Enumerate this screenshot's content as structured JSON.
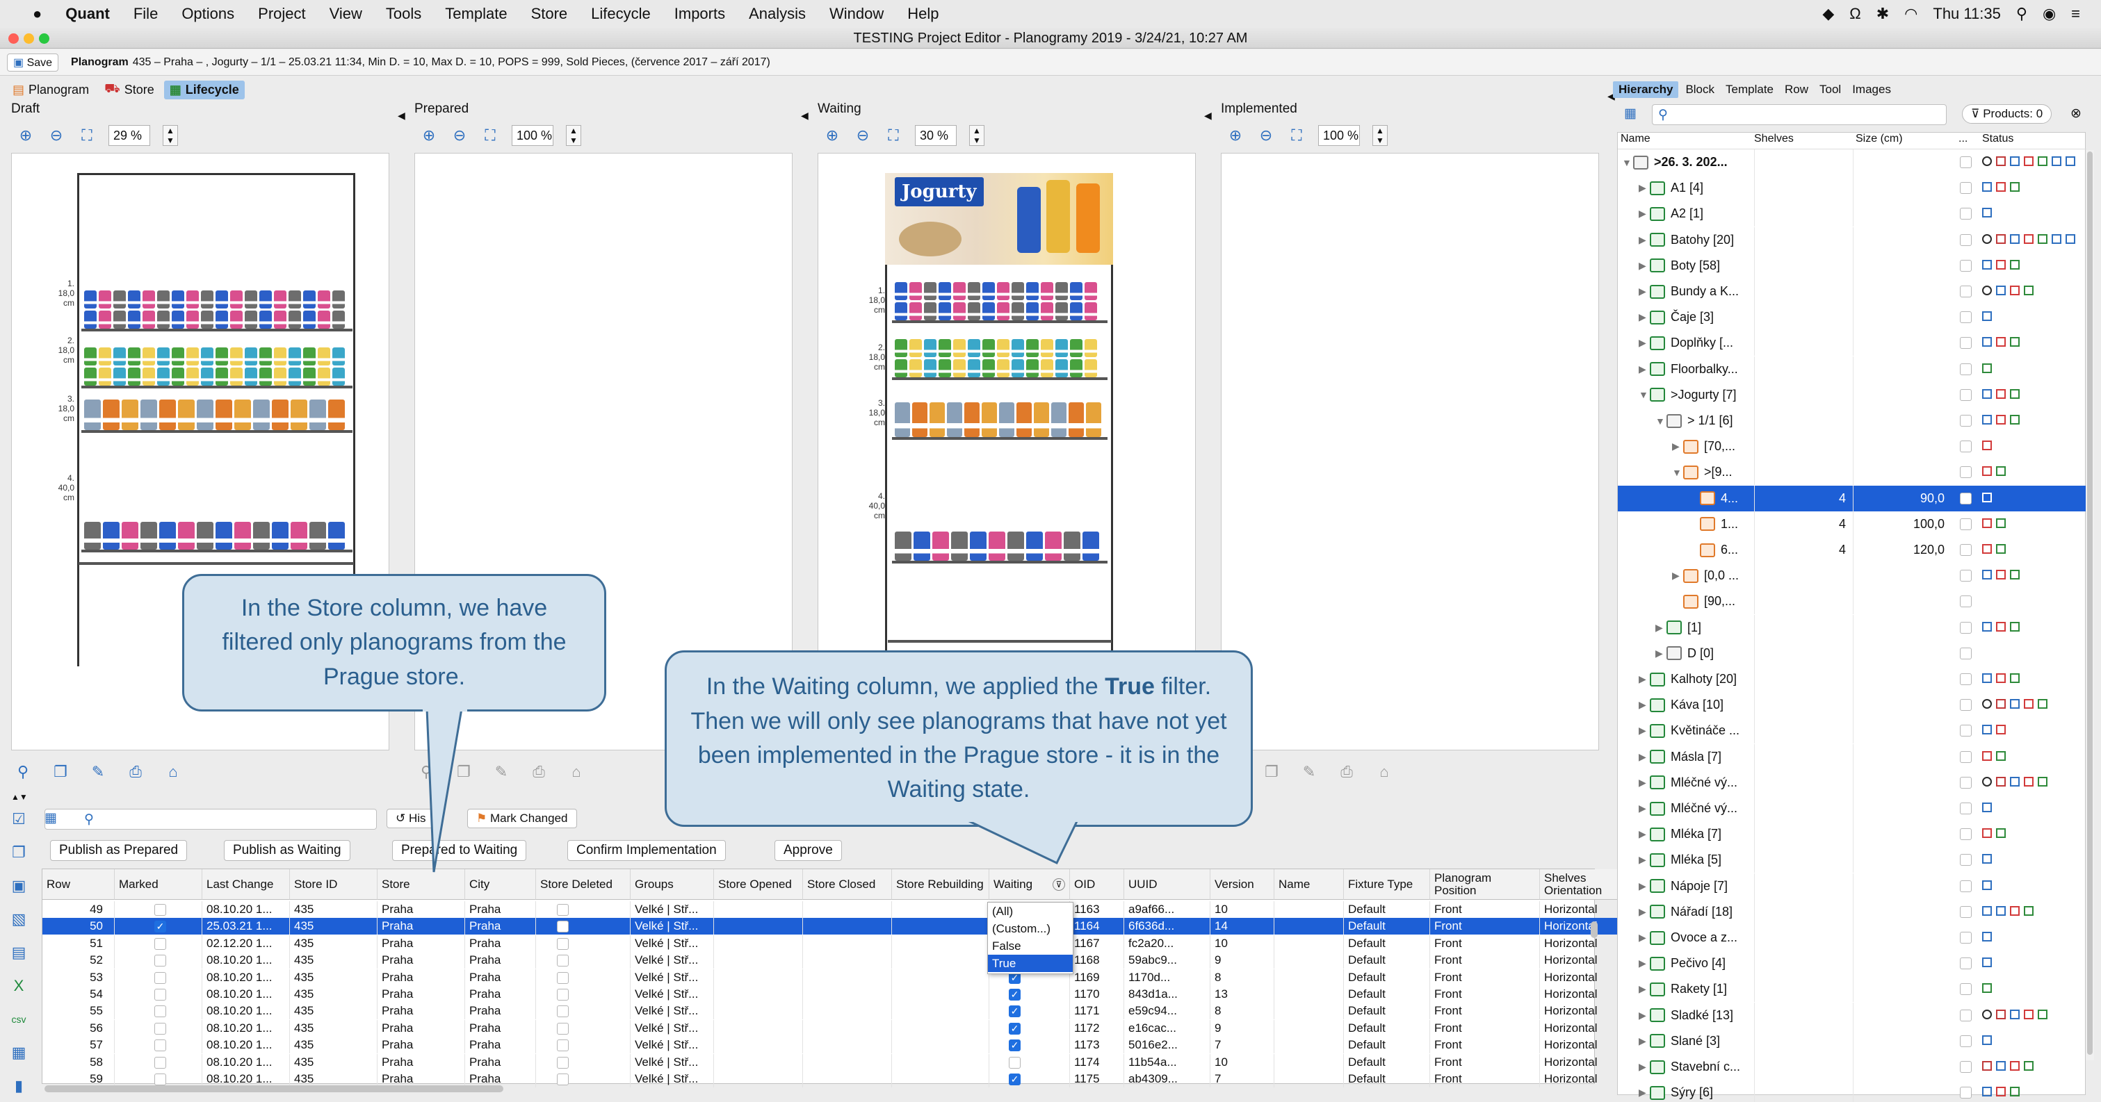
{
  "menubar": {
    "app": "Quant",
    "items": [
      "File",
      "Options",
      "Project",
      "View",
      "Tools",
      "Template",
      "Store",
      "Lifecycle",
      "Imports",
      "Analysis",
      "Window",
      "Help"
    ],
    "clock": "Thu 11:35"
  },
  "window": {
    "title": "TESTING Project Editor - Planogramy 2019 - 3/24/21, 10:27 AM"
  },
  "toolbar": {
    "save_label": "Save",
    "planogram_bold": "Planogram",
    "planogram_info": "435 – Praha – , Jogurty – 1/1 – 25.03.21 11:34, Min D. = 10, Max D. = 10, POPS = 999, Sold Pieces, (července 2017 – září 2017)"
  },
  "view_tabs": [
    {
      "label": "Planogram"
    },
    {
      "label": "Store"
    },
    {
      "label": "Lifecycle"
    }
  ],
  "columns": [
    {
      "title": "Draft",
      "zoom": "29 %"
    },
    {
      "title": "Prepared",
      "zoom": "100 %"
    },
    {
      "title": "Waiting",
      "zoom": "30 %"
    },
    {
      "title": "Implemented",
      "zoom": "100 %"
    }
  ],
  "draft_shelves": [
    {
      "num": "1.",
      "size": "18,0 cm"
    },
    {
      "num": "2.",
      "size": "18,0 cm"
    },
    {
      "num": "3.",
      "size": "18,0 cm"
    },
    {
      "num": "4.",
      "size": "40,0 cm"
    }
  ],
  "waiting_shelves": [
    {
      "num": "1.",
      "size": "18,0 cm"
    },
    {
      "num": "2.",
      "size": "18,0 cm"
    },
    {
      "num": "3.",
      "size": "18,0 cm"
    },
    {
      "num": "4.",
      "size": "40,0 cm"
    }
  ],
  "waiting_banner": "Jogurty",
  "callouts": {
    "store": "In the Store column, we have filtered only planograms from the Prague store.",
    "waiting_pre": "In the Waiting column, we applied the ",
    "waiting_bold": "True",
    "waiting_post": " filter. Then we will only see planograms that have not yet been implemented in the Prague store - it is in the Waiting state."
  },
  "grid_toolbar": {
    "history": "His",
    "mark_changed": "Mark Changed"
  },
  "actions": [
    "Publish as Prepared",
    "Publish as Waiting",
    "Prepared to Waiting",
    "Confirm Implementation",
    "Approve"
  ],
  "grid": {
    "headers": [
      "Row",
      "Marked",
      "Last Change",
      "Store ID",
      "Store",
      "City",
      "Store Deleted",
      "Groups",
      "Store Opened",
      "Store Closed",
      "Store Rebuilding",
      "Waiting",
      "OID",
      "UUID",
      "Version",
      "Name",
      "Fixture Type",
      "Planogram Position",
      "Shelves Orientation"
    ],
    "rows": [
      {
        "row": "49",
        "marked": false,
        "last": "08.10.20 1...",
        "sid": "435",
        "store": "Praha",
        "city": "Praha",
        "groups": "Velké | Stř...",
        "waiting": null,
        "oid": "1163",
        "uuid": "a9af66...",
        "ver": "10",
        "ft": "Default",
        "pos": "Front",
        "orient": "Horizontal"
      },
      {
        "row": "50",
        "marked": true,
        "last": "25.03.21 1...",
        "sid": "435",
        "store": "Praha",
        "city": "Praha",
        "groups": "Velké | Stř...",
        "waiting": null,
        "oid": "1164",
        "uuid": "6f636d...",
        "ver": "14",
        "ft": "Default",
        "pos": "Front",
        "orient": "Horizontal"
      },
      {
        "row": "51",
        "marked": false,
        "last": "02.12.20 1...",
        "sid": "435",
        "store": "Praha",
        "city": "Praha",
        "groups": "Velké | Stř...",
        "waiting": null,
        "oid": "1167",
        "uuid": "fc2a20...",
        "ver": "10",
        "ft": "Default",
        "pos": "Front",
        "orient": "Horizontal"
      },
      {
        "row": "52",
        "marked": false,
        "last": "08.10.20 1...",
        "sid": "435",
        "store": "Praha",
        "city": "Praha",
        "groups": "Velké | Stř...",
        "waiting": null,
        "oid": "1168",
        "uuid": "59abc9...",
        "ver": "9",
        "ft": "Default",
        "pos": "Front",
        "orient": "Horizontal"
      },
      {
        "row": "53",
        "marked": false,
        "last": "08.10.20 1...",
        "sid": "435",
        "store": "Praha",
        "city": "Praha",
        "groups": "Velké | Stř...",
        "waiting": true,
        "oid": "1169",
        "uuid": "1170d...",
        "ver": "8",
        "ft": "Default",
        "pos": "Front",
        "orient": "Horizontal"
      },
      {
        "row": "54",
        "marked": false,
        "last": "08.10.20 1...",
        "sid": "435",
        "store": "Praha",
        "city": "Praha",
        "groups": "Velké | Stř...",
        "waiting": true,
        "oid": "1170",
        "uuid": "843d1a...",
        "ver": "13",
        "ft": "Default",
        "pos": "Front",
        "orient": "Horizontal"
      },
      {
        "row": "55",
        "marked": false,
        "last": "08.10.20 1...",
        "sid": "435",
        "store": "Praha",
        "city": "Praha",
        "groups": "Velké | Stř...",
        "waiting": true,
        "oid": "1171",
        "uuid": "e59c94...",
        "ver": "8",
        "ft": "Default",
        "pos": "Front",
        "orient": "Horizontal"
      },
      {
        "row": "56",
        "marked": false,
        "last": "08.10.20 1...",
        "sid": "435",
        "store": "Praha",
        "city": "Praha",
        "groups": "Velké | Stř...",
        "waiting": true,
        "oid": "1172",
        "uuid": "e16cac...",
        "ver": "9",
        "ft": "Default",
        "pos": "Front",
        "orient": "Horizontal"
      },
      {
        "row": "57",
        "marked": false,
        "last": "08.10.20 1...",
        "sid": "435",
        "store": "Praha",
        "city": "Praha",
        "groups": "Velké | Stř...",
        "waiting": true,
        "oid": "1173",
        "uuid": "5016e2...",
        "ver": "7",
        "ft": "Default",
        "pos": "Front",
        "orient": "Horizontal"
      },
      {
        "row": "58",
        "marked": false,
        "last": "08.10.20 1...",
        "sid": "435",
        "store": "Praha",
        "city": "Praha",
        "groups": "Velké | Stř...",
        "waiting": false,
        "oid": "1174",
        "uuid": "11b54a...",
        "ver": "10",
        "ft": "Default",
        "pos": "Front",
        "orient": "Horizontal"
      },
      {
        "row": "59",
        "marked": false,
        "last": "08.10.20 1...",
        "sid": "435",
        "store": "Praha",
        "city": "Praha",
        "groups": "Velké | Stř...",
        "waiting": true,
        "oid": "1175",
        "uuid": "ab4309...",
        "ver": "7",
        "ft": "Default",
        "pos": "Front",
        "orient": "Horizontal"
      }
    ],
    "filter_options": [
      "(All)",
      "(Custom...)",
      "False",
      "True"
    ],
    "filter_selected": "True"
  },
  "right_tabs": [
    "Hierarchy",
    "Block",
    "Template",
    "Row",
    "Tool",
    "Images"
  ],
  "products_label": "Products: 0",
  "hier_headers": [
    "Name",
    "Shelves",
    "Size (cm)",
    "...",
    "Status"
  ],
  "hierarchy": [
    {
      "indent": 0,
      "arrow": "▼",
      "icon": "grey",
      "name": ">26. 3. 202...",
      "bold": true,
      "shelves": "",
      "size": "",
      "status": "scbrgbb"
    },
    {
      "indent": 1,
      "arrow": "▶",
      "icon": "green",
      "name": "A1 [4]",
      "shelves": "",
      "size": "",
      "status": "brg"
    },
    {
      "indent": 1,
      "arrow": "▶",
      "icon": "green",
      "name": "A2 [1]",
      "shelves": "",
      "size": "",
      "status": "b"
    },
    {
      "indent": 1,
      "arrow": "▶",
      "icon": "green",
      "name": "Batohy [20]",
      "shelves": "",
      "size": "",
      "status": "scbrgbb"
    },
    {
      "indent": 1,
      "arrow": "▶",
      "icon": "green",
      "name": "Boty [58]",
      "shelves": "",
      "size": "",
      "status": "brg"
    },
    {
      "indent": 1,
      "arrow": "▶",
      "icon": "green",
      "name": "Bundy a K...",
      "shelves": "",
      "size": "",
      "status": "sbrg"
    },
    {
      "indent": 1,
      "arrow": "▶",
      "icon": "green",
      "name": "Čaje [3]",
      "shelves": "",
      "size": "",
      "status": "b"
    },
    {
      "indent": 1,
      "arrow": "▶",
      "icon": "green",
      "name": "Doplňky [...",
      "shelves": "",
      "size": "",
      "status": "brg"
    },
    {
      "indent": 1,
      "arrow": "▶",
      "icon": "green",
      "name": "Floorbalky...",
      "shelves": "",
      "size": "",
      "status": "g"
    },
    {
      "indent": 1,
      "arrow": "▼",
      "icon": "green",
      "name": ">Jogurty [7]",
      "shelves": "",
      "size": "",
      "status": "brg"
    },
    {
      "indent": 2,
      "arrow": "▼",
      "icon": "grey",
      "name": "> 1/1 [6]",
      "shelves": "",
      "size": "",
      "status": "brg"
    },
    {
      "indent": 3,
      "arrow": "▶",
      "icon": "orange",
      "name": "[70,...",
      "shelves": "",
      "size": "",
      "status": "r"
    },
    {
      "indent": 3,
      "arrow": "▼",
      "icon": "orange",
      "name": ">[9...",
      "shelves": "",
      "size": "",
      "status": "rg"
    },
    {
      "indent": 4,
      "arrow": "",
      "icon": "orange",
      "name": "4...",
      "shelves": "4",
      "size": "90,0",
      "status": "r",
      "selected": true
    },
    {
      "indent": 4,
      "arrow": "",
      "icon": "orange",
      "name": "1...",
      "shelves": "4",
      "size": "100,0",
      "status": "rg"
    },
    {
      "indent": 4,
      "arrow": "",
      "icon": "orange",
      "name": "6...",
      "shelves": "4",
      "size": "120,0",
      "status": "rg"
    },
    {
      "indent": 3,
      "arrow": "▶",
      "icon": "orange",
      "name": "[0,0 ...",
      "shelves": "",
      "size": "",
      "status": "brg"
    },
    {
      "indent": 3,
      "arrow": "",
      "icon": "orange",
      "name": "[90,...",
      "shelves": "",
      "size": "",
      "status": ""
    },
    {
      "indent": 2,
      "arrow": "▶",
      "icon": "green",
      "name": "[1]",
      "shelves": "",
      "size": "",
      "status": "brg"
    },
    {
      "indent": 2,
      "arrow": "▶",
      "icon": "grey",
      "name": "D [0]",
      "shelves": "",
      "size": "",
      "status": ""
    },
    {
      "indent": 1,
      "arrow": "▶",
      "icon": "green",
      "name": "Kalhoty [20]",
      "shelves": "",
      "size": "",
      "status": "brg"
    },
    {
      "indent": 1,
      "arrow": "▶",
      "icon": "green",
      "name": "Káva [10]",
      "shelves": "",
      "size": "",
      "status": "scbrg"
    },
    {
      "indent": 1,
      "arrow": "▶",
      "icon": "green",
      "name": "Květináče ...",
      "shelves": "",
      "size": "",
      "status": "br"
    },
    {
      "indent": 1,
      "arrow": "▶",
      "icon": "green",
      "name": "Másla [7]",
      "shelves": "",
      "size": "",
      "status": "rg"
    },
    {
      "indent": 1,
      "arrow": "▶",
      "icon": "green",
      "name": "Mléčné vý...",
      "shelves": "",
      "size": "",
      "status": "scbrg"
    },
    {
      "indent": 1,
      "arrow": "▶",
      "icon": "green",
      "name": "Mléčné vý...",
      "shelves": "",
      "size": "",
      "status": "b"
    },
    {
      "indent": 1,
      "arrow": "▶",
      "icon": "green",
      "name": "Mléka [7]",
      "shelves": "",
      "size": "",
      "status": "rg"
    },
    {
      "indent": 1,
      "arrow": "▶",
      "icon": "green",
      "name": "Mléka [5]",
      "shelves": "",
      "size": "",
      "status": "b"
    },
    {
      "indent": 1,
      "arrow": "▶",
      "icon": "green",
      "name": "Nápoje [7]",
      "shelves": "",
      "size": "",
      "status": "b"
    },
    {
      "indent": 1,
      "arrow": "▶",
      "icon": "green",
      "name": "Nářadí [18]",
      "shelves": "",
      "size": "",
      "status": "bbrg"
    },
    {
      "indent": 1,
      "arrow": "▶",
      "icon": "green",
      "name": "Ovoce a z...",
      "shelves": "",
      "size": "",
      "status": "b"
    },
    {
      "indent": 1,
      "arrow": "▶",
      "icon": "green",
      "name": "Pečivo [4]",
      "shelves": "",
      "size": "",
      "status": "b"
    },
    {
      "indent": 1,
      "arrow": "▶",
      "icon": "green",
      "name": "Rakety [1]",
      "shelves": "",
      "size": "",
      "status": "g"
    },
    {
      "indent": 1,
      "arrow": "▶",
      "icon": "green",
      "name": "Sladké [13]",
      "shelves": "",
      "size": "",
      "status": "scbrg"
    },
    {
      "indent": 1,
      "arrow": "▶",
      "icon": "green",
      "name": "Slané [3]",
      "shelves": "",
      "size": "",
      "status": "b"
    },
    {
      "indent": 1,
      "arrow": "▶",
      "icon": "green",
      "name": "Stavební c...",
      "shelves": "",
      "size": "",
      "status": "cbrg"
    },
    {
      "indent": 1,
      "arrow": "▶",
      "icon": "green",
      "name": "Sýry [6]",
      "shelves": "",
      "size": "",
      "status": "brg"
    }
  ],
  "colors": {
    "selection": "#1d5fd6",
    "callout_fill": "#d4e3ef",
    "callout_border": "#3e6d96",
    "callout_text": "#2b5f8e",
    "accent": "#2e6fbf"
  }
}
